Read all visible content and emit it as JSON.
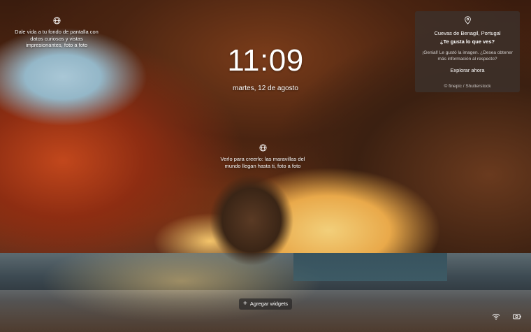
{
  "lockscreen": {
    "time": "11:09",
    "date": "martes, 12 de agosto"
  },
  "hints": {
    "left": "Dale vida a tu fondo de pantalla con datos curiosos y vistas impresionantes, foto a foto",
    "center": "Verlo para creerlo: las maravillas del mundo llegan hasta ti, foto a foto"
  },
  "spotlight_card": {
    "location": "Cuevas de Benagil, Portugal",
    "question": "¿Te gusta lo que ves?",
    "description": "¡Genial! Le gustó la imagen. ¿Desea obtener más información al respecto?",
    "explore_label": "Explorar ahora",
    "credit": "© finepic / Shutterstock"
  },
  "widgets": {
    "plus": "+",
    "label": "Agregar widgets"
  },
  "icons": {
    "globe": "globe-icon",
    "location": "location-pin-icon",
    "wifi": "wifi-icon",
    "battery": "battery-icon"
  }
}
